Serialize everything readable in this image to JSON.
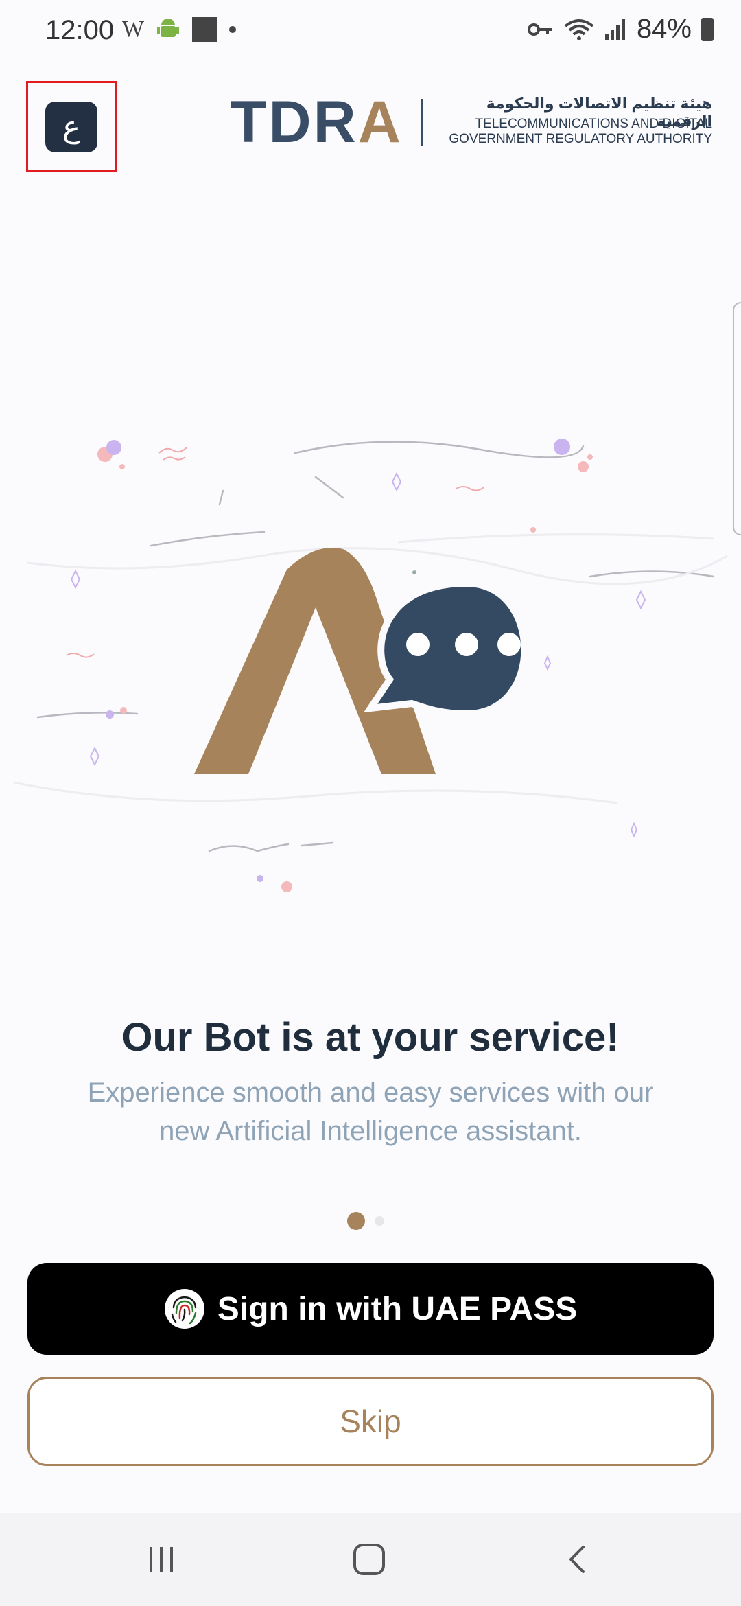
{
  "status_bar": {
    "time": "12:00",
    "left_icons": [
      "wikipedia-w-icon",
      "android-icon",
      "square-icon",
      "dot-icon"
    ],
    "battery": "84%",
    "right_icons": [
      "vpn-key-icon",
      "wifi-icon",
      "signal-icon",
      "battery-icon"
    ]
  },
  "header": {
    "lang_button_label": "ع",
    "logo": {
      "word_start": "TDR",
      "word_end": "A",
      "arabic": "هيئة تنظيم الاتصالات والحكومة الرقمية",
      "english_line1": "TELECOMMUNICATIONS AND DIGITAL",
      "english_line2": "GOVERNMENT REGULATORY AUTHORITY"
    }
  },
  "main": {
    "headline": "Our Bot is at your service!",
    "subtitle": "Experience smooth and easy services with our new Artificial Intelligence assistant.",
    "pager": {
      "total": 2,
      "active": 1
    }
  },
  "buttons": {
    "uae_pass_label": "Sign in with UAE PASS",
    "skip_label": "Skip"
  },
  "colors": {
    "brand_gold": "#a6835b",
    "brand_navy": "#233043",
    "bubble_navy": "#344a62",
    "highlight_red": "#e21b23"
  }
}
